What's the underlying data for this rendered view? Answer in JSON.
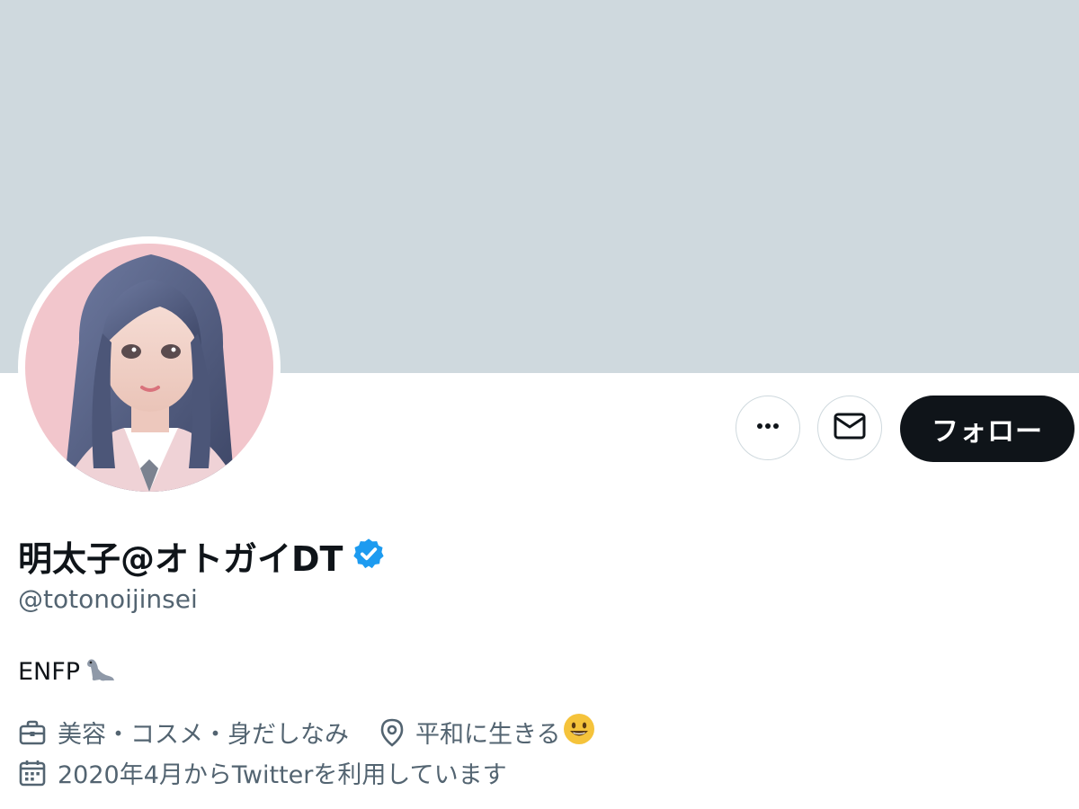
{
  "banner": {
    "color": "#cfd9de"
  },
  "actions": {
    "more_icon": "more-horizontal-icon",
    "dm_icon": "envelope-icon",
    "follow_label": "フォロー"
  },
  "profile": {
    "display_name": "明太子@オトガイDT",
    "verified_icon": "verified-badge-icon",
    "verified_color": "#1d9bf0",
    "handle": "@totonoijinsei",
    "bio_text": "ENFP",
    "bio_emoji": "seal-emoji",
    "category": "美容・コスメ・身だしなみ",
    "category_icon": "briefcase-icon",
    "location": "平和に生きる",
    "location_icon": "location-pin-icon",
    "location_emoji": "smiley-emoji",
    "joined": "2020年4月からTwitterを利用しています",
    "joined_icon": "calendar-icon"
  },
  "colors": {
    "text_primary": "#0f1419",
    "text_secondary": "#536471",
    "button_dark": "#0f1419"
  }
}
